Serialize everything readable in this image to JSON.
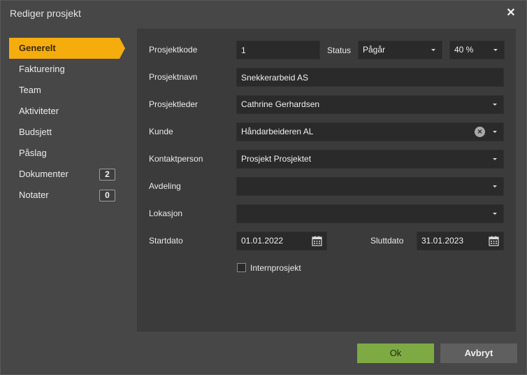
{
  "dialog": {
    "title": "Rediger prosjekt"
  },
  "sidebar": {
    "items": [
      {
        "label": "Generelt",
        "active": true
      },
      {
        "label": "Fakturering"
      },
      {
        "label": "Team"
      },
      {
        "label": "Aktiviteter"
      },
      {
        "label": "Budsjett"
      },
      {
        "label": "Påslag"
      },
      {
        "label": "Dokumenter",
        "badge": "2"
      },
      {
        "label": "Notater",
        "badge": "0"
      }
    ]
  },
  "form": {
    "prosjektkode": {
      "label": "Prosjektkode",
      "value": "1"
    },
    "status": {
      "label": "Status",
      "value": "Pågår"
    },
    "progress": {
      "value": "40 %"
    },
    "prosjektnavn": {
      "label": "Prosjektnavn",
      "value": "Snekkerarbeid AS"
    },
    "prosjektleder": {
      "label": "Prosjektleder",
      "value": "Cathrine Gerhardsen"
    },
    "kunde": {
      "label": "Kunde",
      "value": "Håndarbeideren AL"
    },
    "kontaktperson": {
      "label": "Kontaktperson",
      "value": "Prosjekt Prosjektet"
    },
    "avdeling": {
      "label": "Avdeling",
      "value": ""
    },
    "lokasjon": {
      "label": "Lokasjon",
      "value": ""
    },
    "startdato": {
      "label": "Startdato",
      "value": "01.01.2022"
    },
    "sluttdato": {
      "label": "Sluttdato",
      "value": "31.01.2023"
    },
    "internprosjekt": {
      "label": "Internprosjekt",
      "checked": false
    }
  },
  "footer": {
    "ok_label": "Ok",
    "cancel_label": "Avbryt"
  },
  "colors": {
    "accent": "#f5ad0e",
    "ok": "#7eaa44",
    "panel": "#3b3b3b",
    "background": "#474747"
  }
}
